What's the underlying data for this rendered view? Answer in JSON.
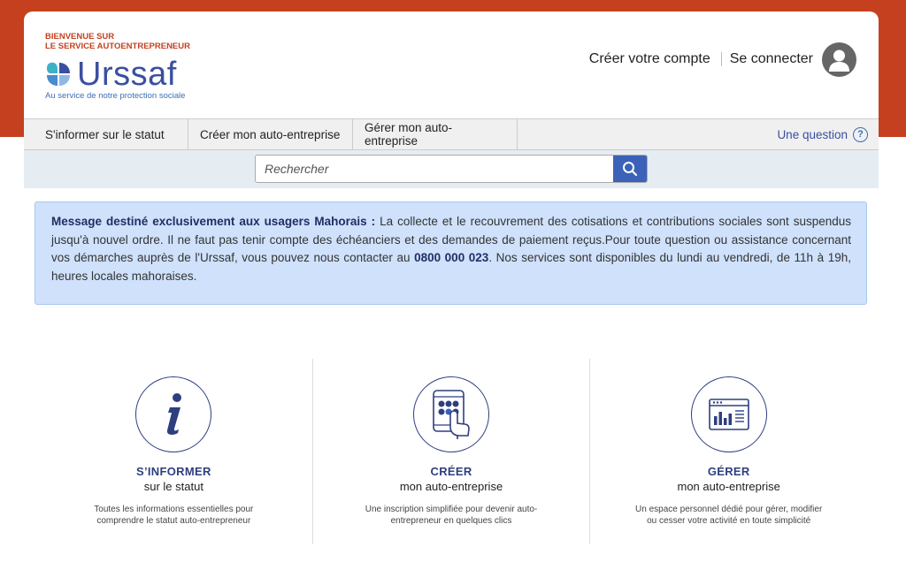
{
  "brand": {
    "welcome_line1": "BIENVENUE SUR",
    "welcome_line2": "LE SERVICE AUTOENTREPRENEUR",
    "name": "Urssaf",
    "tagline": "Au service de notre protection sociale",
    "accent_color": "#c4401f",
    "primary_color": "#2e3f7f"
  },
  "account": {
    "create_label": "Créer votre compte",
    "login_label": "Se connecter",
    "avatar_icon": "user-avatar-icon"
  },
  "nav": {
    "items": [
      {
        "label": "S'informer sur le statut"
      },
      {
        "label": "Créer mon auto-entreprise"
      },
      {
        "label": "Gérer mon auto-entreprise"
      }
    ],
    "question_label": "Une question",
    "question_icon": "?"
  },
  "search": {
    "placeholder": "Rechercher",
    "value": "",
    "button_icon": "search-icon"
  },
  "alert": {
    "lead": "Message destiné exclusivement aux usagers Mahorais :",
    "text1": " La collecte et le recouvrement des cotisations et contributions sociales sont suspendus jusqu'à nouvel ordre. Il ne faut pas tenir compte des échéanciers et des demandes de paiement reçus.Pour toute question ou assistance concernant vos démarches auprès de l'Urssaf, vous pouvez nous contacter au ",
    "phone": "0800 000 023",
    "text2": ". Nos services sont disponibles du lundi au vendredi, de 11h à 19h, heures locales mahoraises.",
    "background": "#cfe1fb"
  },
  "features": [
    {
      "icon": "info-icon",
      "title": "S’INFORMER",
      "subtitle": "sur le statut",
      "description": "Toutes les informations essentielles pour comprendre le statut auto-entrepreneur"
    },
    {
      "icon": "tablet-touch-icon",
      "title": "CRÉER",
      "subtitle": "mon auto-entreprise",
      "description": "Une inscription simplifiée pour devenir auto-entrepreneur en quelques clics"
    },
    {
      "icon": "dashboard-chart-icon",
      "title": "GÉRER",
      "subtitle": "mon auto-entreprise",
      "description": "Un espace personnel dédié pour gérer, modifier ou cesser votre activité en toute simplicité"
    }
  ]
}
